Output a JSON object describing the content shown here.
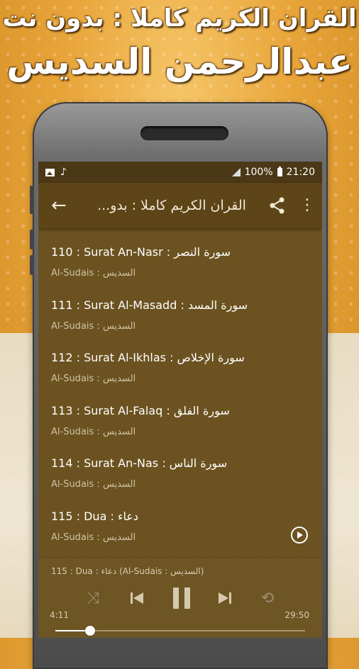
{
  "promo": {
    "line1": "القران الكريم كاملا : بدون نت",
    "line2": "عبدالرحمن السديس"
  },
  "statusbar": {
    "battery": "100%",
    "time": "21:20",
    "icons": [
      "image-icon",
      "music-note-icon",
      "signal-icon",
      "battery-icon"
    ]
  },
  "appbar": {
    "title": "القران الكريم كاملا : بدو...",
    "back_icon": "arrow-back-icon",
    "share_icon": "share-icon",
    "more_icon": "more-vert-icon"
  },
  "surahs": [
    {
      "title": "110 : Surat An-Nasr : سورة النصر",
      "reciter": "Al-Sudais : السديس"
    },
    {
      "title": "111 : Surat Al-Masadd : سورة المسد",
      "reciter": "Al-Sudais : السديس"
    },
    {
      "title": "112 : Surat Al-Ikhlas : سورة الإخلاص",
      "reciter": "Al-Sudais : السديس"
    },
    {
      "title": "113 : Surat Al-Falaq : سورة الفلق",
      "reciter": "Al-Sudais : السديس"
    },
    {
      "title": "114 : Surat An-Nas : سورة الناس",
      "reciter": "Al-Sudais : السديس"
    },
    {
      "title": "115 : Dua : دعاء",
      "reciter": "Al-Sudais : السديس"
    }
  ],
  "player": {
    "now_playing": "115 : Dua : دعاء (Al-Sudais : السديس)",
    "elapsed": "4:11",
    "total": "29:50",
    "progress": 0.14
  },
  "colors": {
    "appbar": "#5d4518",
    "statusbar": "#4a3816",
    "list_bg": "#6b5220",
    "accent": "#ffffff"
  }
}
